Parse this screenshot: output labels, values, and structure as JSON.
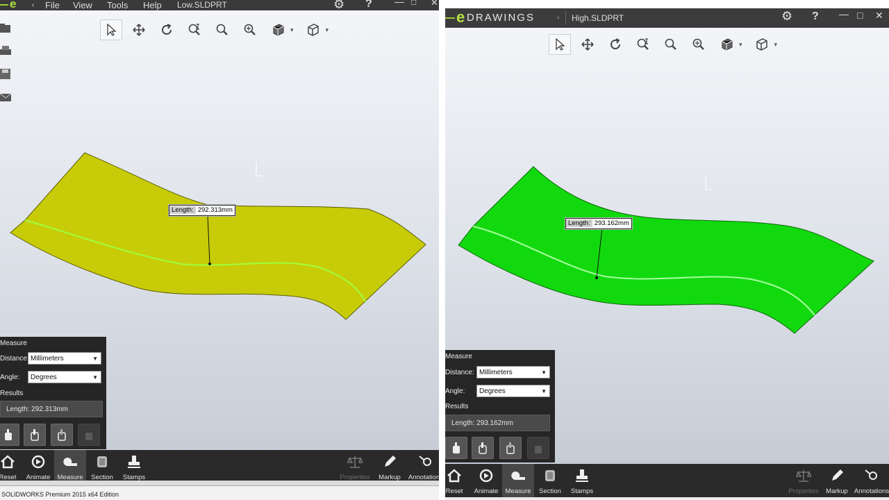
{
  "left": {
    "menu": [
      "File",
      "View",
      "Tools",
      "Help"
    ],
    "filename": "Low.SLDPRT",
    "measure_label": {
      "key": "Length:",
      "value": "292.313mm"
    },
    "panel": {
      "title": "Measure",
      "distance_label": "Distance:",
      "distance_value": "Millimeters",
      "angle_label": "Angle:",
      "angle_value": "Degrees",
      "results_label": "Results",
      "result_text": "Length: 292.313mm"
    },
    "bottom": [
      "Reset",
      "Animate",
      "Measure",
      "Section",
      "Stamps",
      "Properties",
      "Markup",
      "Annotations"
    ],
    "status": "SOLIDWORKS Premium 2015 x64 Edition",
    "part_color": "#c8cc08"
  },
  "right": {
    "logo_text": "DRAWINGS",
    "filename": "High.SLDPRT",
    "measure_label": {
      "key": "Length:",
      "value": "293.162mm"
    },
    "panel": {
      "title": "Measure",
      "distance_label": "Distance:",
      "distance_value": "Millimeters",
      "angle_label": "Angle:",
      "angle_value": "Degrees",
      "results_label": "Results",
      "result_text": "Length: 293.162mm"
    },
    "bottom": [
      "Reset",
      "Animate",
      "Measure",
      "Section",
      "Stamps",
      "Properties",
      "Markup",
      "Annotations"
    ],
    "part_color": "#12d90e"
  },
  "icons": [
    "select-icon",
    "pan-icon",
    "rotate-icon",
    "zoom-fit-icon",
    "zoom-area-icon",
    "zoom-icon",
    "view-orientation-icon",
    "display-style-icon"
  ]
}
